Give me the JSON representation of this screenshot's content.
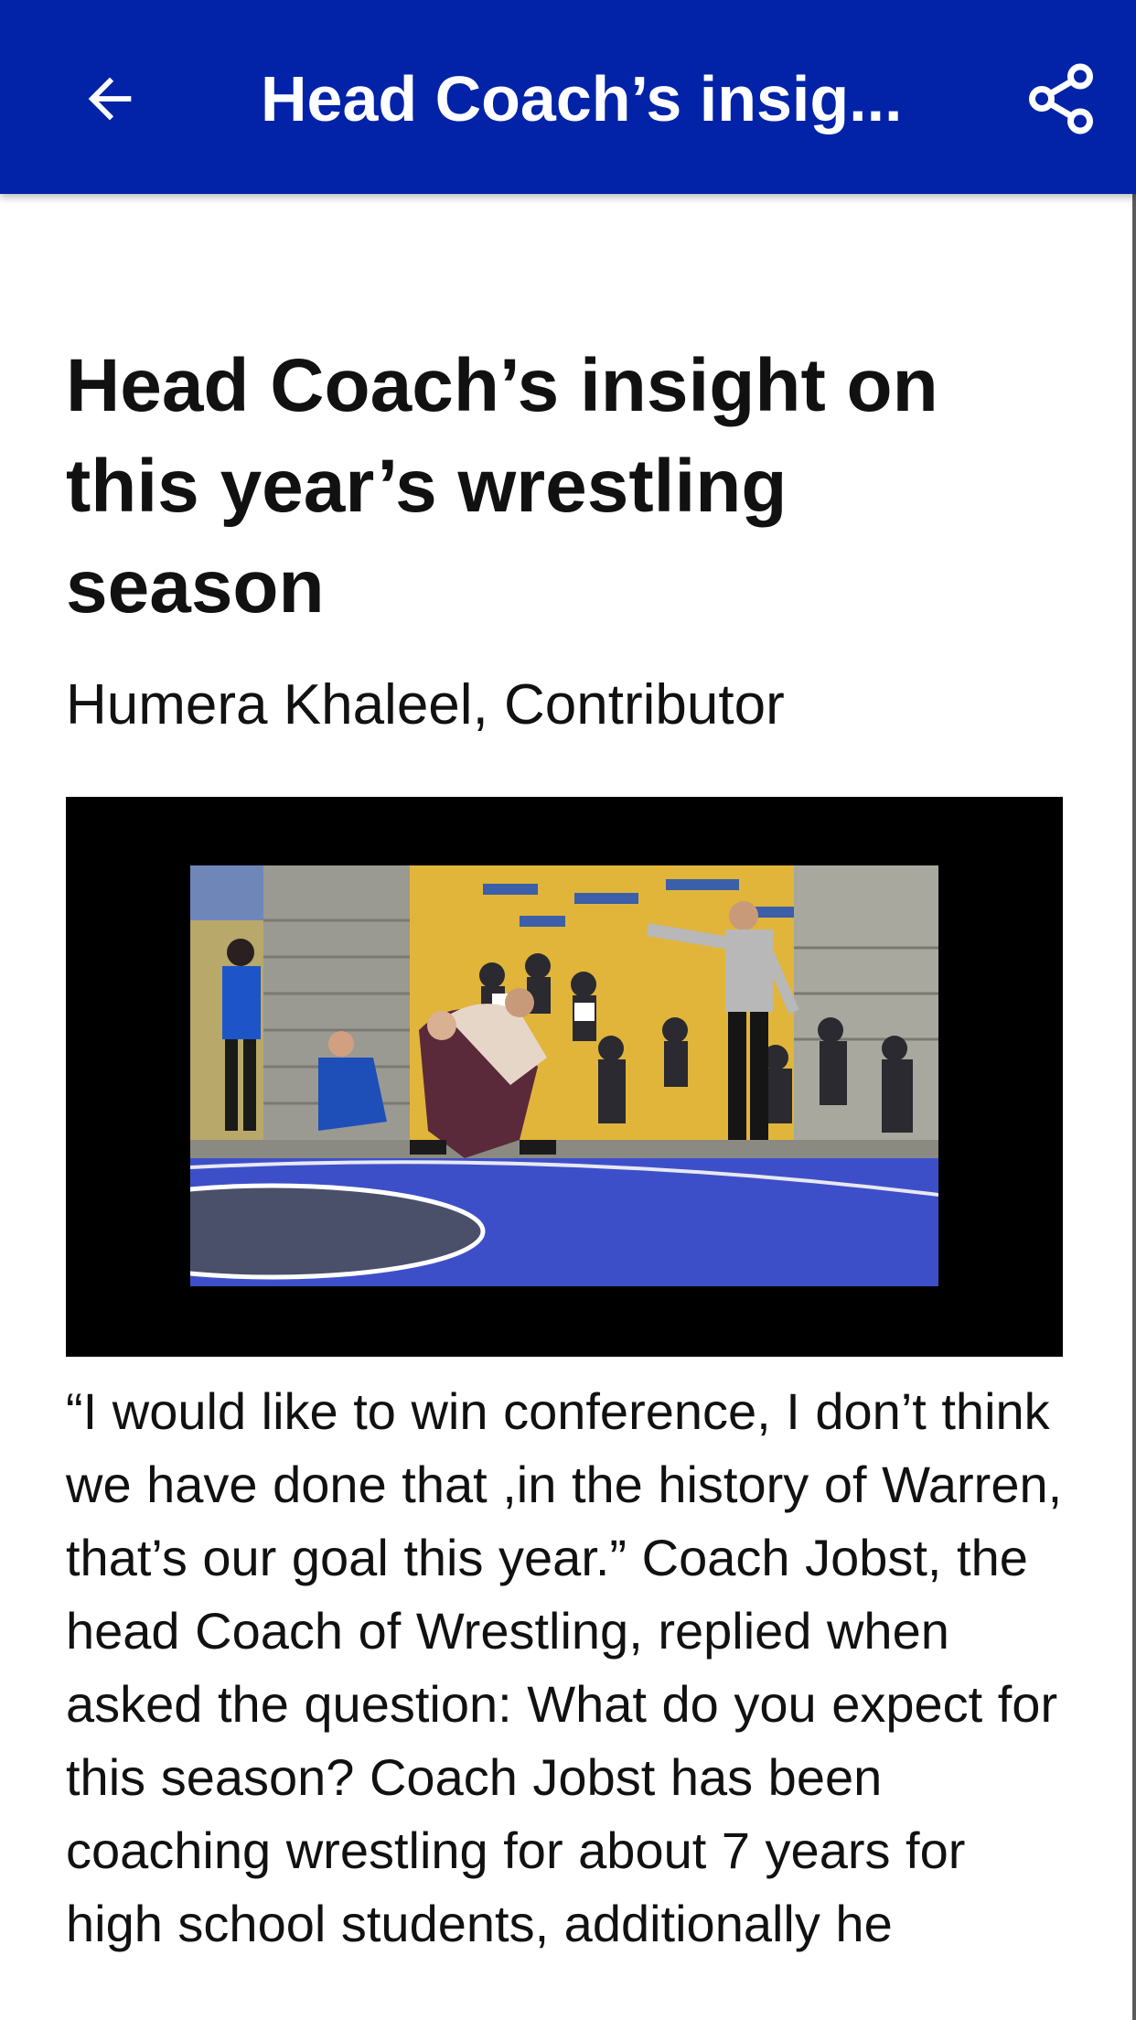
{
  "app_bar": {
    "title": "Head Coach’s insig...",
    "back_icon": "arrow-left-icon",
    "share_icon": "share-icon",
    "color": "#0223a8"
  },
  "article": {
    "headline": "Head Coach’s insight on this year’s wrestling season",
    "byline": "Humera Khaleel, Contributor",
    "video": {
      "description_icon": "video-thumbnail"
    },
    "body": "“I would like to win conference, I don’t think we have done that ,in the history of Warren, that’s our goal this year.” Coach Jobst, the head Coach of Wrestling, replied when asked the question: What do you expect for this season? Coach Jobst has been coaching wrestling for about 7 years for high school students, additionally he"
  }
}
